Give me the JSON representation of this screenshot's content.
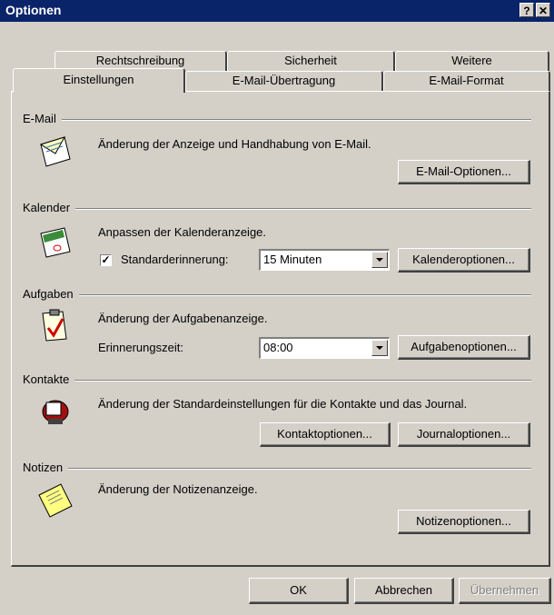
{
  "window": {
    "title": "Optionen",
    "help_glyph": "?",
    "close_glyph": "✕"
  },
  "tabs": {
    "back": [
      {
        "label": "Rechtschreibung"
      },
      {
        "label": "Sicherheit"
      },
      {
        "label": "Weitere"
      }
    ],
    "front": [
      {
        "label": "Einstellungen"
      },
      {
        "label": "E-Mail-Übertragung"
      },
      {
        "label": "E-Mail-Format"
      }
    ]
  },
  "sections": {
    "email": {
      "title": "E-Mail",
      "desc": "Änderung der Anzeige und Handhabung von E-Mail.",
      "button": "E-Mail-Optionen..."
    },
    "calendar": {
      "title": "Kalender",
      "desc": "Anpassen der Kalenderanzeige.",
      "reminder_label": "Standarderinnerung:",
      "reminder_checked": true,
      "reminder_value": "15 Minuten",
      "button": "Kalenderoptionen..."
    },
    "tasks": {
      "title": "Aufgaben",
      "desc": "Änderung der Aufgabenanzeige.",
      "time_label": "Erinnerungszeit:",
      "time_value": "08:00",
      "button": "Aufgabenoptionen..."
    },
    "contacts": {
      "title": "Kontakte",
      "desc": "Änderung der Standardeinstellungen für die Kontakte und das Journal.",
      "button_contacts": "Kontaktoptionen...",
      "button_journal": "Journaloptionen..."
    },
    "notes": {
      "title": "Notizen",
      "desc": "Änderung der Notizenanzeige.",
      "button": "Notizenoptionen..."
    }
  },
  "footer": {
    "ok": "OK",
    "cancel": "Abbrechen",
    "apply": "Übernehmen"
  },
  "icons": {
    "email": "envelope-icon",
    "calendar": "calendar-icon",
    "tasks": "clipboard-check-icon",
    "contacts": "rolodex-icon",
    "notes": "sticky-note-icon"
  },
  "colors": {
    "face": "#d4d0c8",
    "titlebar": "#0a246a",
    "shadow": "#808080"
  }
}
